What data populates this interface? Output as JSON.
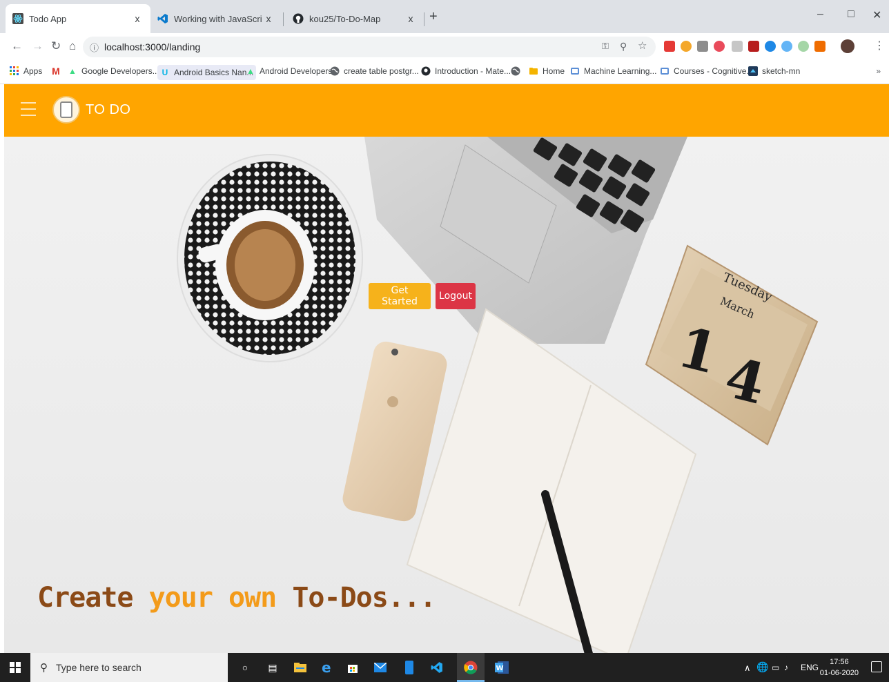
{
  "browser": {
    "tabs": [
      {
        "title": "Todo App",
        "active": true
      },
      {
        "title": "Working with JavaScript in Visual",
        "active": false
      },
      {
        "title": "kou25/To-Do-Map",
        "active": false
      }
    ],
    "close_glyph": "x",
    "url": "localhost:3000/landing",
    "bookmarks": [
      {
        "label": "Apps"
      },
      {
        "label": ""
      },
      {
        "label": "Google Developers..."
      },
      {
        "label": "Android Basics Nan..."
      },
      {
        "label": "Android Developers"
      },
      {
        "label": "create table postgr..."
      },
      {
        "label": "Introduction - Mate..."
      },
      {
        "label": ""
      },
      {
        "label": "Home"
      },
      {
        "label": "Machine Learning..."
      },
      {
        "label": "Courses - Cognitive..."
      },
      {
        "label": "sketch-mn"
      }
    ],
    "bookmarks_overflow": "»"
  },
  "app": {
    "brand": "TO DO",
    "buttons": {
      "get_started": "Get Started",
      "logout": "Logout"
    },
    "tagline": {
      "part1": "Create ",
      "part2": "your own ",
      "part3": "To-Dos..."
    },
    "hero_calendar": {
      "day": "Tuesday",
      "month": "March",
      "date_digit_1": "1",
      "date_digit_2": "4"
    },
    "colors": {
      "header": "#ffa500",
      "get_started": "#f6b21b",
      "logout": "#dc3545",
      "tagline_dark": "#8b4a17",
      "tagline_light": "#f39b1a"
    }
  },
  "taskbar": {
    "search_placeholder": "Type here to search",
    "language": "ENG",
    "time": "17:56",
    "date": "01-06-2020"
  }
}
